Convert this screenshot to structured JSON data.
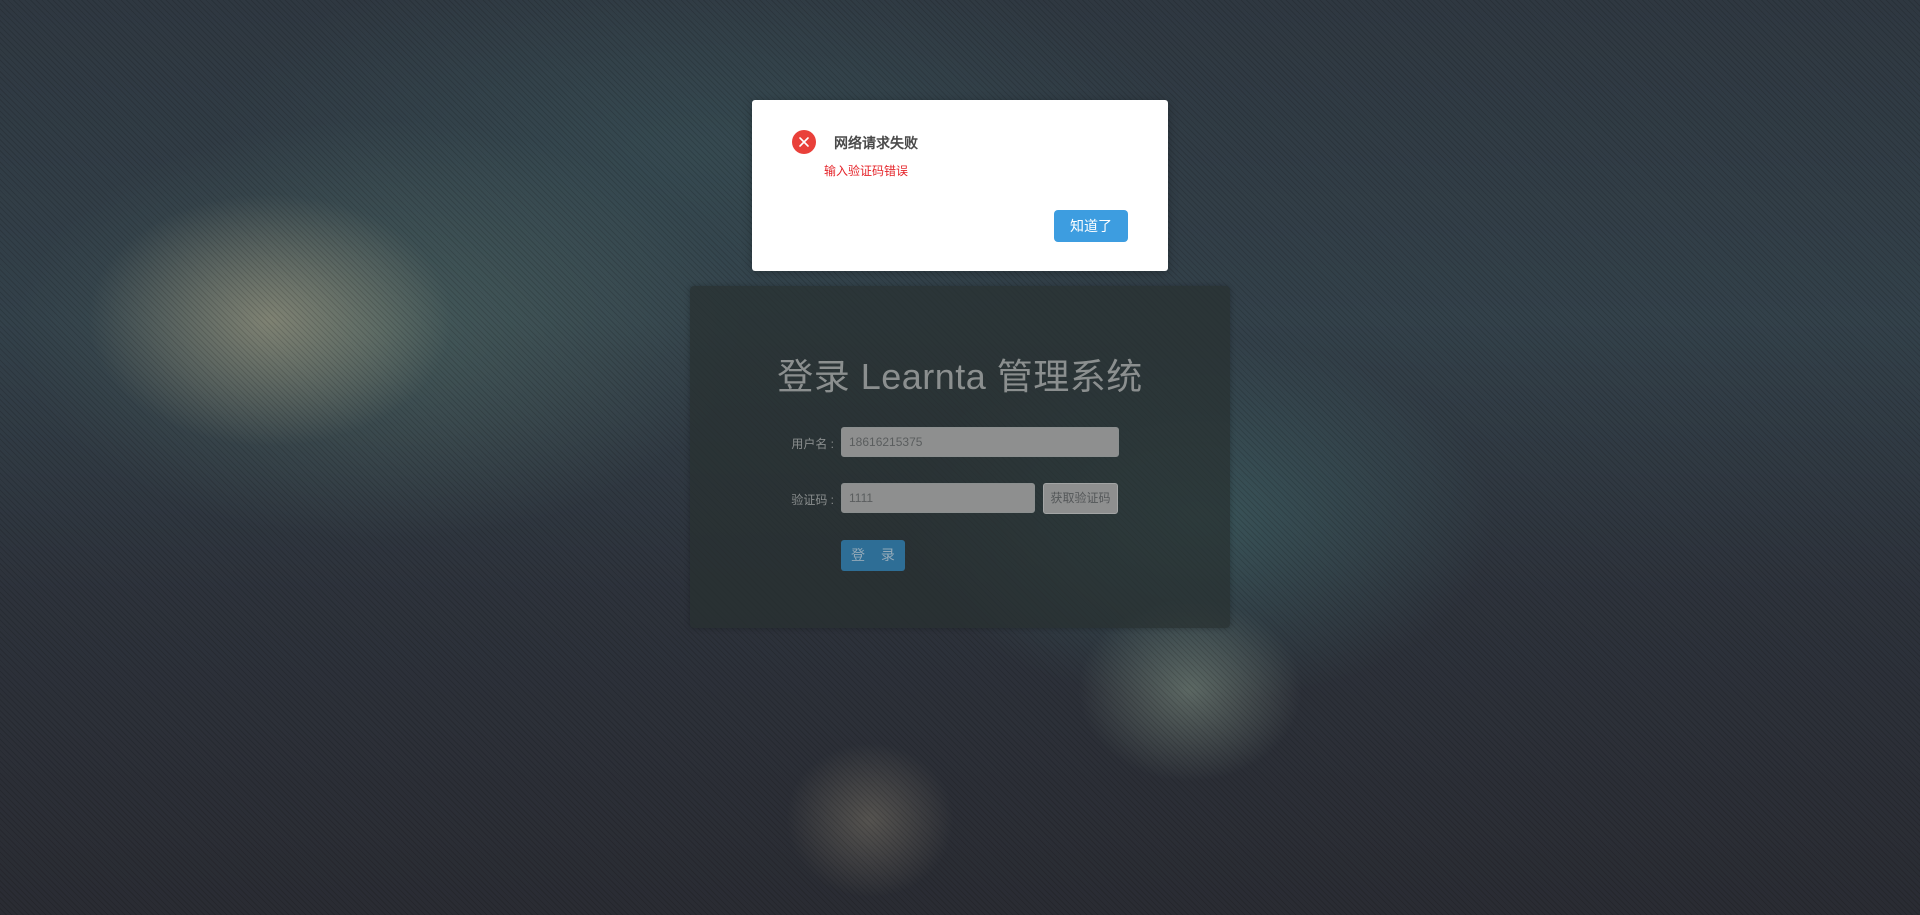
{
  "login": {
    "title": "登录 Learnta 管理系统",
    "username_label": "用户名 :",
    "username_value": "18616215375",
    "code_label": "验证码 :",
    "code_value": "1111",
    "get_code_label": "获取验证码",
    "submit_label": "登 录"
  },
  "dialog": {
    "title": "网络请求失败",
    "message": "输入验证码错误",
    "ok_label": "知道了",
    "icon": "error-circle-icon",
    "icon_color": "#e9403a",
    "message_color": "#e5242a",
    "button_color": "#3d9de0"
  }
}
